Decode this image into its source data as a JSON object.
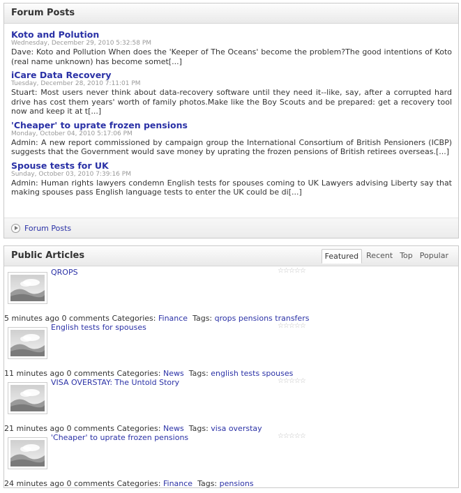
{
  "forum": {
    "title": "Forum Posts",
    "posts": [
      {
        "title": "Koto and Polution",
        "date": "Wednesday, December 29, 2010 5:32:58 PM",
        "excerpt": "Dave: Koto and Pollution When does the 'Keeper of The Oceans' become the problem?The good intentions of Koto (real name unknown) has become somet[...]"
      },
      {
        "title": "iCare Data Recovery",
        "date": "Tuesday, December 28, 2010 7:11:01 PM",
        "excerpt": "Stuart: Most users never think about data-recovery software until they need it--like, say, after a corrupted hard drive has cost them years' worth of family photos.Make like the Boy Scouts and be prepared: get a recovery tool now and keep it at t[...]"
      },
      {
        "title": "'Cheaper' to uprate frozen pensions",
        "date": "Monday, October 04, 2010 5:17:06 PM",
        "excerpt": "Admin: A new report commissioned by campaign group the International Consortium of British Pensioners (ICBP) suggests that the Government would save money by uprating the frozen pensions of British retirees overseas.[...]"
      },
      {
        "title": "Spouse tests for UK",
        "date": "Sunday, October 03, 2010 7:39:16 PM",
        "excerpt": "Admin: Human rights lawyers condemn English tests for spouses coming to UK Lawyers advising Liberty say that making spouses pass English language tests to enter the UK could be di[...]"
      }
    ],
    "footer_link": "Forum Posts"
  },
  "articles": {
    "title": "Public Articles",
    "tabs": [
      "Featured",
      "Recent",
      "Top",
      "Popular"
    ],
    "active_tab": "Featured",
    "items": [
      {
        "title": "QROPS",
        "age": "5 minutes ago",
        "comments": "0 comments",
        "categories_label": "Categories:",
        "category": "Finance",
        "tags_label": "Tags:",
        "tags": "qrops pensions transfers",
        "rating": 0
      },
      {
        "title": "English tests for spouses",
        "age": "11 minutes ago",
        "comments": "0 comments",
        "categories_label": "Categories:",
        "category": "News",
        "tags_label": "Tags:",
        "tags": "english tests spouses",
        "rating": 0
      },
      {
        "title": "VISA OVERSTAY: The Untold Story",
        "age": "21 minutes ago",
        "comments": "0 comments",
        "categories_label": "Categories:",
        "category": "News",
        "tags_label": "Tags:",
        "tags": "visa overstay",
        "rating": 0
      },
      {
        "title": "'Cheaper' to uprate frozen pensions",
        "age": "24 minutes ago",
        "comments": "0 comments",
        "categories_label": "Categories:",
        "category": "Finance",
        "tags_label": "Tags:",
        "tags": "pensions",
        "rating": 0
      }
    ]
  },
  "colors": {
    "link": "#2a31a6",
    "date": "#999999",
    "border": "#c9c9c9"
  },
  "icons": {
    "footer": "circle-arrow-right-icon",
    "thumbnail": "image-placeholder-icon",
    "rating": "star-icon"
  }
}
